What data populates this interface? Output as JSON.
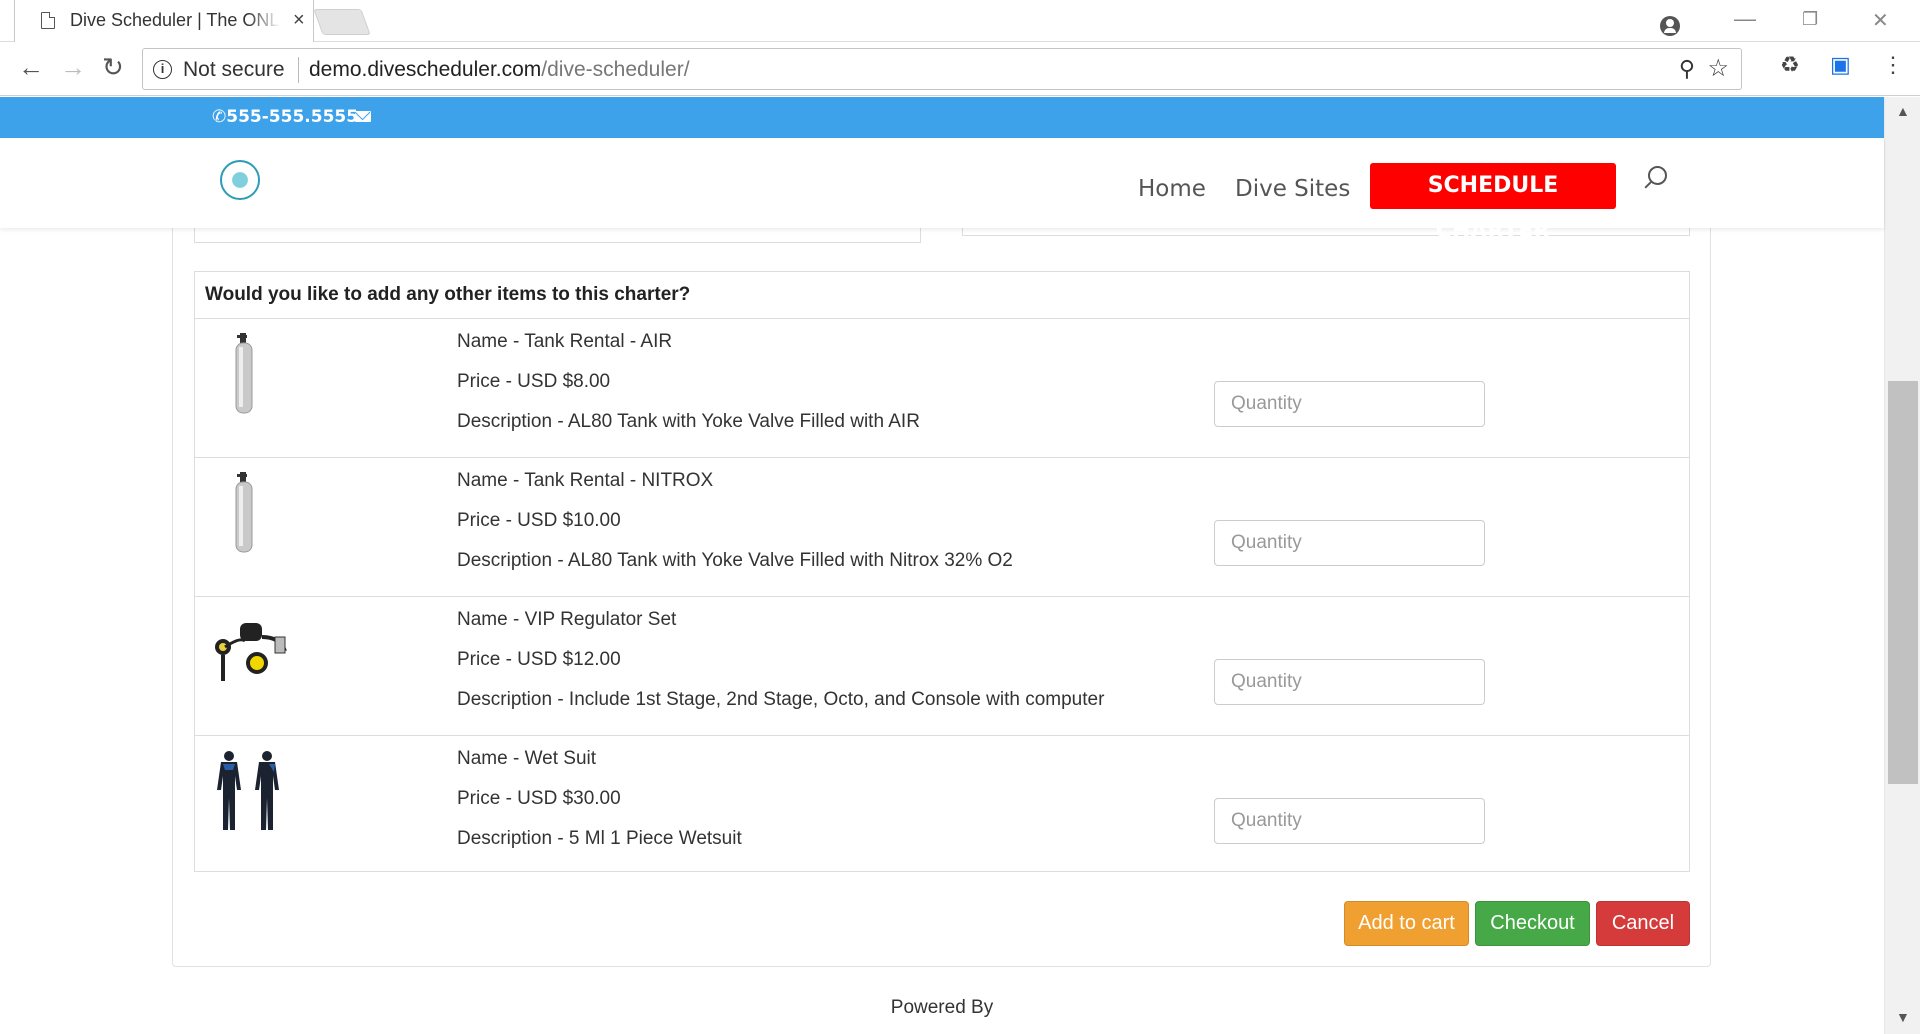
{
  "browser": {
    "tab_title": "Dive Scheduler | The ONLINE",
    "tab_close": "×",
    "security_label": "Not secure",
    "url_domain": "demo.divescheduler.com",
    "url_path": "/dive-scheduler/",
    "win_minimize": "—",
    "win_restore": "❐",
    "win_close": "✕"
  },
  "site": {
    "phone": "555-555.5555",
    "menu": {
      "home": "Home",
      "dive_sites": "Dive Sites",
      "schedule": "SCHEDULE CHARTER"
    }
  },
  "addons": {
    "heading": "Would you like to add any other items to this charter?",
    "items": [
      {
        "name": "Name - Tank Rental - AIR",
        "price": "Price - USD $8.00",
        "description": "Description - AL80 Tank with Yoke Valve Filled with AIR",
        "quantity_placeholder": "Quantity",
        "icon": "air-tank-icon"
      },
      {
        "name": "Name - Tank Rental - NITROX",
        "price": "Price - USD $10.00",
        "description": "Description - AL80 Tank with Yoke Valve Filled with Nitrox 32% O2",
        "quantity_placeholder": "Quantity",
        "icon": "nitrox-tank-icon"
      },
      {
        "name": "Name - VIP Regulator Set",
        "price": "Price - USD $12.00",
        "description": "Description - Include 1st Stage, 2nd Stage, Octo, and Console with computer",
        "quantity_placeholder": "Quantity",
        "icon": "regulator-icon"
      },
      {
        "name": "Name - Wet Suit",
        "price": "Price - USD $30.00",
        "description": "Description - 5 Ml 1 Piece Wetsuit",
        "quantity_placeholder": "Quantity",
        "icon": "wetsuit-icon"
      }
    ]
  },
  "actions": {
    "add_to_cart": "Add to cart",
    "checkout": "Checkout",
    "cancel": "Cancel"
  },
  "footer": {
    "powered_by": "Powered By"
  },
  "colors": {
    "topbar": "#3da2ea",
    "schedule_button": "#ff0000",
    "add_to_cart": "#f0a030",
    "checkout": "#46a846",
    "cancel": "#d63b3b"
  }
}
